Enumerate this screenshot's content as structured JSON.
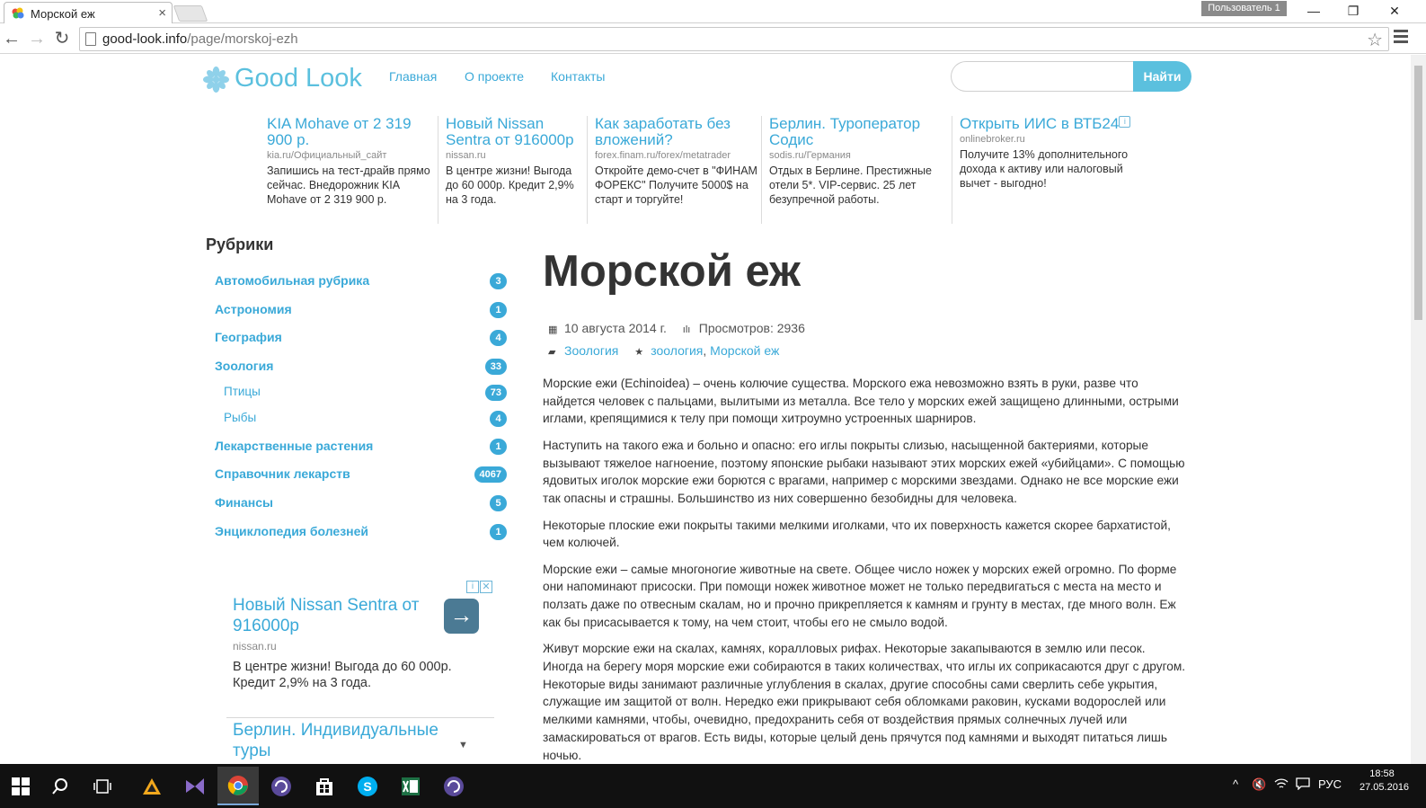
{
  "browser": {
    "tab_title": "Морской еж",
    "tab_close": "×",
    "profile_label": "Пользователь 1",
    "window_controls": {
      "minimize": "—",
      "restore": "❐",
      "close": "✕"
    },
    "nav": {
      "back": "←",
      "forward": "→",
      "reload": "↻"
    },
    "url_host": "good-look.info",
    "url_path": "/page/morskoj-ezh",
    "bookmark_star": "☆"
  },
  "site": {
    "logo_text": "Good Look",
    "nav": [
      "Главная",
      "О проекте",
      "Контакты"
    ],
    "search": {
      "value": "",
      "button": "Найти"
    }
  },
  "ads_top": [
    {
      "title": "KIA Mohave от 2 319 900 р.",
      "domain": "kia.ru/Официальный_сайт",
      "text": "Запишись на тест-драйв прямо сейчас. Внедорожник KIA Mohave от 2 319 900 р."
    },
    {
      "title": "Новый Nissan Sentra от 916000р",
      "domain": "nissan.ru",
      "text": "В центре жизни! Выгода до 60 000р. Кредит 2,9% на 3 года."
    },
    {
      "title": "Как заработать без вложений?",
      "domain": "forex.finam.ru/forex/metatrader",
      "text": "Откройте демо-счет в \"ФИНАМ ФОРЕКС\" Получите 5000$ на старт и торгуйте!"
    },
    {
      "title": "Берлин. Туроператор Содис",
      "domain": "sodis.ru/Германия",
      "text": "Отдых в Берлине. Престижные отели 5*. VIP-сервис. 25 лет безупречной работы."
    },
    {
      "title": "Открыть ИИС в ВТБ24",
      "domain": "onlinebroker.ru",
      "text": "Получите 13% дополнительного дохода к активу или налоговый вычет - выгодно!"
    }
  ],
  "ad_info_glyph": "i",
  "sidebar": {
    "heading": "Рубрики",
    "categories": [
      {
        "label": "Автомобильная рубрика",
        "count": "3",
        "sub": false
      },
      {
        "label": "Астрономия",
        "count": "1",
        "sub": false
      },
      {
        "label": "География",
        "count": "4",
        "sub": false
      },
      {
        "label": "Зоология",
        "count": "33",
        "sub": false
      },
      {
        "label": "Птицы",
        "count": "73",
        "sub": true
      },
      {
        "label": "Рыбы",
        "count": "4",
        "sub": true
      },
      {
        "label": "Лекарственные растения",
        "count": "1",
        "sub": false
      },
      {
        "label": "Справочник лекарств",
        "count": "4067",
        "sub": false
      },
      {
        "label": "Финансы",
        "count": "5",
        "sub": false
      },
      {
        "label": "Энциклопедия болезней",
        "count": "1",
        "sub": false
      }
    ]
  },
  "side_ad": {
    "info": "i",
    "close": "✕",
    "title": "Новый Nissan Sentra от 916000р",
    "arrow": "→",
    "domain": "nissan.ru",
    "text": "В центре жизни! Выгода до 60 000р. Кредит 2,9% на 3 года.",
    "title2": "Берлин. Индивидуальные туры",
    "chevron": "▼"
  },
  "article": {
    "title": "Морской еж",
    "date": "10 августа 2014 г.",
    "views": "Просмотров: 2936",
    "category": "Зоология",
    "tags": [
      "зоология",
      "Морской еж"
    ],
    "tag_separator": ", ",
    "paragraphs": [
      "Морские ежи (Echinoidea) – очень колючие существа. Морского ежа невозможно взять в руки, разве что найдется человек с пальцами, вылитыми из металла. Все тело у морских ежей защищено длинными, острыми иглами, крепящимися к телу при помощи хитроумно устроенных шарниров.",
      "Наступить на такого ежа и больно и опасно: его иглы покрыты слизью, насыщенной бактериями, которые вызывают тяжелое нагноение, поэтому японские рыбаки называют этих морских ежей «убийцами». С помощью ядовитых иголок морские ежи борются с врагами, например с морскими звездами. Однако не все морские ежи так опасны и страшны. Большинство из них совершенно безобидны для человека.",
      "Некоторые плоские ежи покрыты такими мелкими иголками, что их поверхность кажется скорее бархатистой, чем колючей.",
      "Морские ежи – самые многоногие животные на свете. Общее число ножек у морских ежей огромно. По форме они напоминают присоски. При помощи ножек животное может не только передвигаться с места на место и ползать даже по отвесным скалам, но и прочно прикрепляется к камням и грунту в местах, где много волн. Еж как бы присасывается к тому, на чем стоит, чтобы его не смыло водой.",
      "Живут морские ежи на скалах, камнях, коралловых рифах. Некоторые закапываются в землю или песок. Иногда на берегу моря морские ежи собираются в таких количествах, что иглы их соприкасаются друг с другом. Некоторые виды занимают различные углубления в скалах, другие способны сами сверлить себе укрытия, служащие им защитой от волн. Нередко ежи прикрывают себя обломками раковин, кусками водорослей или мелкими камнями, чтобы, очевидно, предохранить себя от воздействия прямых солнечных лучей или замаскироваться от врагов. Есть виды, которые целый день прячутся под камнями и выходят питаться лишь ночью."
    ]
  },
  "taskbar": {
    "tray_chevron": "^",
    "tray_volume": "🔇",
    "language": "РУС",
    "time": "18:58",
    "date": "27.05.2016"
  },
  "colors": {
    "accent": "#3aa9d8",
    "logo": "#5bc0de",
    "taskbar": "#111111"
  }
}
